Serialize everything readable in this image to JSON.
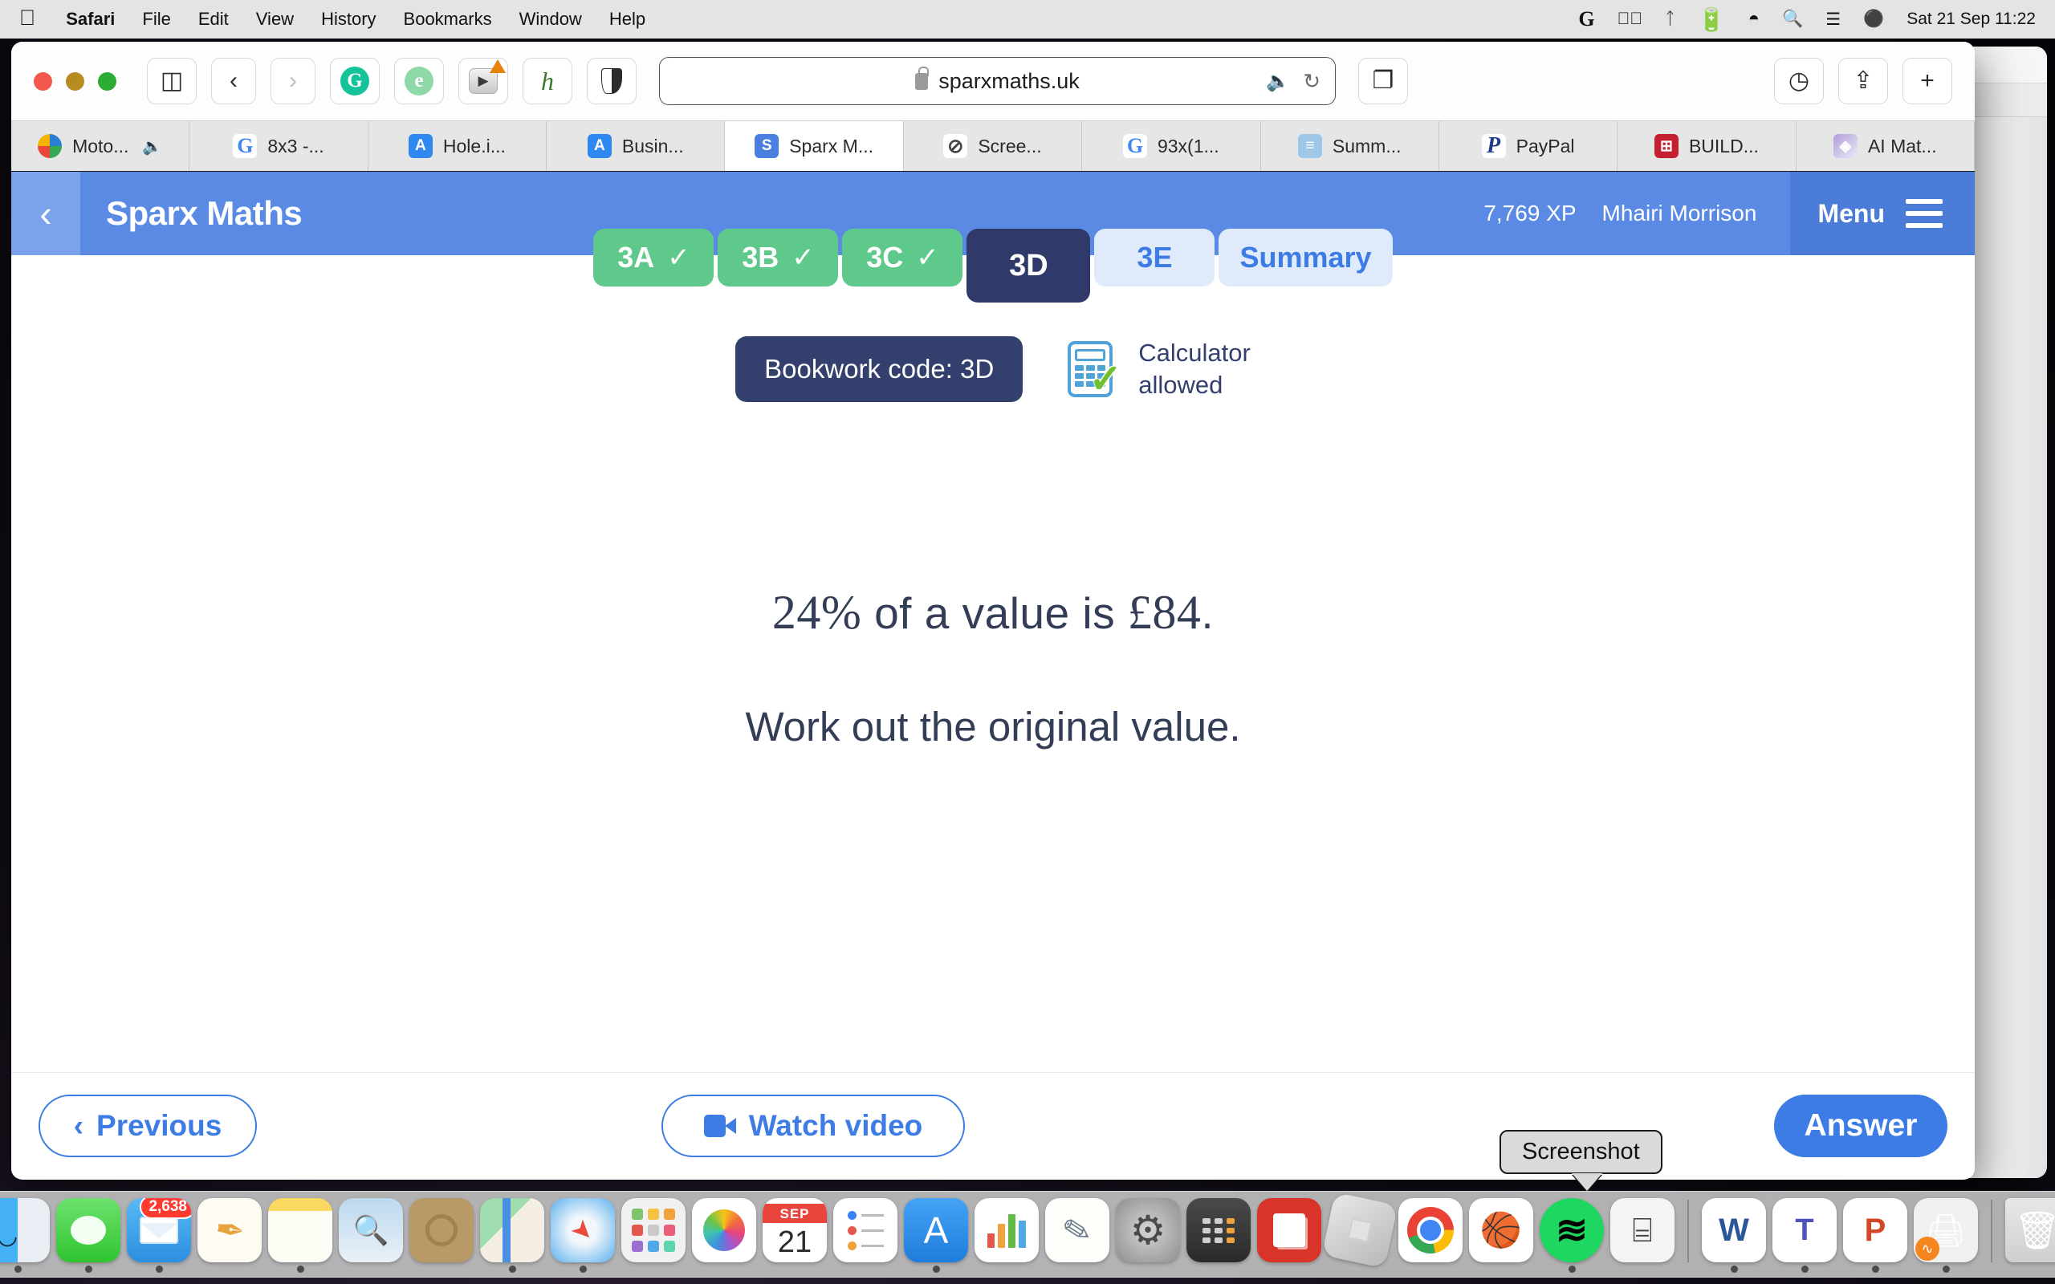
{
  "menubar": {
    "apple": "",
    "items": [
      {
        "label": "Safari",
        "bold": true
      },
      {
        "label": "File",
        "bold": false
      },
      {
        "label": "Edit",
        "bold": false
      },
      {
        "label": "View",
        "bold": false
      },
      {
        "label": "History",
        "bold": false
      },
      {
        "label": "Bookmarks",
        "bold": false
      },
      {
        "label": "Window",
        "bold": false
      },
      {
        "label": "Help",
        "bold": false
      }
    ],
    "status_icons": [
      "grammarly-icon",
      "play-circle-icon",
      "bluetooth-icon",
      "battery-icon",
      "wifi-icon",
      "spotlight-search-icon",
      "control-center-icon",
      "siri-icon"
    ],
    "clock": "Sat 21 Sep  11:22"
  },
  "browser": {
    "url": "sparxmaths.uk",
    "url_lock": "lock-icon",
    "audio_indicator": "speaker-icon",
    "reload": "reload-icon",
    "toolbar_icons": [
      "sidebar-icon",
      "back-icon",
      "forward-icon",
      "grammarly-extension",
      "grammarly-alt-extension",
      "video-extension",
      "honey-extension",
      "shield-extension"
    ],
    "right_icons": [
      "tab-overview-icon",
      "history-icon",
      "share-icon",
      "new-tab-icon"
    ],
    "tabs": [
      {
        "label": "Moto...",
        "favicon": "fav-moto",
        "glyph": "",
        "audio": true,
        "active": false
      },
      {
        "label": "8x3 -...",
        "favicon": "fav-google",
        "glyph": "G",
        "audio": false,
        "active": false
      },
      {
        "label": "Hole.i...",
        "favicon": "fav-atom",
        "glyph": "A",
        "audio": false,
        "active": false
      },
      {
        "label": "Busin...",
        "favicon": "fav-atom",
        "glyph": "A",
        "audio": false,
        "active": false
      },
      {
        "label": "Sparx M...",
        "favicon": "fav-sparx",
        "glyph": "S",
        "audio": false,
        "active": true
      },
      {
        "label": "Scree...",
        "favicon": "fav-compass",
        "glyph": "⊘",
        "audio": false,
        "active": false
      },
      {
        "label": "93x(1...",
        "favicon": "fav-google",
        "glyph": "G",
        "audio": false,
        "active": false
      },
      {
        "label": "Summ...",
        "favicon": "fav-summ",
        "glyph": "≡",
        "audio": false,
        "active": false
      },
      {
        "label": "PayPal",
        "favicon": "fav-paypal",
        "glyph": "P",
        "audio": false,
        "active": false
      },
      {
        "label": "BUILD...",
        "favicon": "fav-build",
        "glyph": "⊞",
        "audio": false,
        "active": false
      },
      {
        "label": "AI Mat...",
        "favicon": "fav-ai",
        "glyph": "◈",
        "audio": false,
        "active": false
      }
    ]
  },
  "sparx": {
    "back_icon": "chevron-left-icon",
    "title": "Sparx Maths",
    "xp": "7,769 XP",
    "user": "Mhairi Morrison",
    "menu_label": "Menu",
    "menu_icon": "hamburger-icon",
    "question_tabs": [
      {
        "label": "3A",
        "state": "done",
        "tick": "✓"
      },
      {
        "label": "3B",
        "state": "done",
        "tick": "✓"
      },
      {
        "label": "3C",
        "state": "done",
        "tick": "✓"
      },
      {
        "label": "3D",
        "state": "current",
        "tick": ""
      },
      {
        "label": "3E",
        "state": "todo",
        "tick": ""
      },
      {
        "label": "Summary",
        "state": "todo",
        "tick": ""
      }
    ],
    "bookwork_code": "Bookwork code: 3D",
    "calculator_icon": "calculator-allowed-icon",
    "calculator_line1": "Calculator",
    "calculator_line2": "allowed",
    "question": {
      "line1_percent": "24%",
      "line1_mid": " of a value is ",
      "line1_amount": "£84",
      "line1_end": ".",
      "line2": "Work out the original value."
    },
    "footer": {
      "previous": "Previous",
      "previous_icon": "chevron-left-icon",
      "watch_video": "Watch video",
      "video_icon": "video-camera-icon",
      "answer": "Answer"
    }
  },
  "tooltip": {
    "label": "Screenshot"
  },
  "dock": {
    "items": [
      {
        "name": "finder",
        "cls": "ic-finder",
        "badge": "",
        "running": true
      },
      {
        "name": "messages",
        "cls": "ic-messages",
        "badge": "",
        "running": true
      },
      {
        "name": "mail",
        "cls": "ic-mail",
        "badge": "2,638",
        "running": true
      },
      {
        "name": "pages",
        "cls": "ic-pages",
        "badge": "",
        "running": false
      },
      {
        "name": "notes",
        "cls": "ic-notes",
        "badge": "",
        "running": true
      },
      {
        "name": "preview",
        "cls": "ic-preview",
        "badge": "",
        "running": false
      },
      {
        "name": "contacts",
        "cls": "ic-contacts",
        "badge": "",
        "running": false
      },
      {
        "name": "maps",
        "cls": "ic-maps",
        "badge": "",
        "running": true
      },
      {
        "name": "safari",
        "cls": "ic-safari",
        "badge": "",
        "running": true
      },
      {
        "name": "launchpad",
        "cls": "ic-launchpad",
        "badge": "",
        "running": false
      },
      {
        "name": "photos",
        "cls": "ic-photos",
        "badge": "",
        "running": false
      },
      {
        "name": "calendar",
        "cls": "ic-calendar",
        "badge": "",
        "running": false
      },
      {
        "name": "reminders",
        "cls": "ic-reminders",
        "badge": "",
        "running": false
      },
      {
        "name": "app-store",
        "cls": "ic-appstore",
        "badge": "",
        "running": true
      },
      {
        "name": "numbers",
        "cls": "ic-numbers",
        "badge": "",
        "running": false
      },
      {
        "name": "keynote",
        "cls": "ic-keynote2",
        "badge": "",
        "running": false
      },
      {
        "name": "system-preferences",
        "cls": "ic-sysprefs",
        "badge": "",
        "running": false
      },
      {
        "name": "calculator",
        "cls": "ic-calculator",
        "badge": "",
        "running": false
      },
      {
        "name": "photo-booth",
        "cls": "ic-photobooth",
        "badge": "",
        "running": false
      },
      {
        "name": "roblox",
        "cls": "ic-roblox",
        "badge": "",
        "running": false
      },
      {
        "name": "chrome",
        "cls": "ic-chrome",
        "badge": "",
        "running": false
      },
      {
        "name": "basketball-app",
        "cls": "ic-basket",
        "badge": "",
        "running": false
      },
      {
        "name": "spotify",
        "cls": "ic-spotify",
        "badge": "",
        "running": true
      },
      {
        "name": "screenshot",
        "cls": "ic-screenshot",
        "badge": "",
        "running": false
      },
      {
        "name": "word",
        "cls": "ic-word",
        "badge": "",
        "running": true
      },
      {
        "name": "teams",
        "cls": "ic-teams",
        "badge": "",
        "running": true
      },
      {
        "name": "powerpoint",
        "cls": "ic-ppt",
        "badge": "",
        "running": true
      },
      {
        "name": "printer",
        "cls": "ic-printer",
        "badge": "",
        "running": true
      },
      {
        "name": "trash",
        "cls": "ic-trash",
        "badge": "",
        "running": false
      }
    ],
    "calendar_month": "SEP",
    "calendar_day": "21"
  },
  "colors": {
    "sparx_blue": "#5b8ae5",
    "sparx_navy": "#33406e",
    "green_done": "#5ec98a",
    "accent_blue": "#3d7ce4",
    "light_blue_tab": "#dfeafb"
  }
}
